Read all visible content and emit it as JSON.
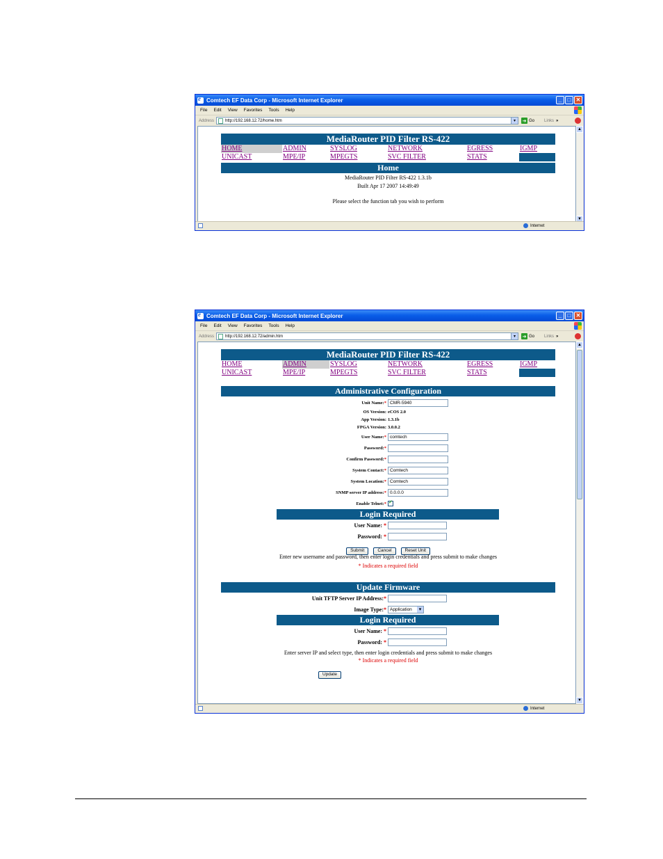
{
  "browser": {
    "title": "Comtech EF Data Corp - Microsoft Internet Explorer",
    "menu": [
      "File",
      "Edit",
      "View",
      "Favorites",
      "Tools",
      "Help"
    ],
    "address_label": "Address",
    "go_label": "Go",
    "links_label": "Links",
    "links_chevron": "»",
    "status_zone": "Internet"
  },
  "window_controls": {
    "minimize": "_",
    "maximize": "□",
    "close": "✕"
  },
  "win1": {
    "url": "http://192.168.12.72/home.htm",
    "header": "MediaRouter PID Filter RS-422",
    "nav_row1": [
      "HOME",
      "ADMIN",
      "SYSLOG",
      "NETWORK",
      "EGRESS",
      "IGMP"
    ],
    "nav_row2": [
      "UNICAST",
      "MPE/IP",
      "MPEGTS",
      "SVC FILTER",
      "STATS"
    ],
    "section": "Home",
    "version": "MediaRouter PID Filter RS-422 1.3.1b",
    "built": "Built Apr 17 2007 14:49:49",
    "prompt": "Please select the function tab you wish to perform"
  },
  "win2": {
    "url": "http://192.168.12.72/admin.htm",
    "header": "MediaRouter PID Filter RS-422",
    "nav_row1": [
      "HOME",
      "ADMIN",
      "SYSLOG",
      "NETWORK",
      "EGRESS",
      "IGMP"
    ],
    "nav_row2": [
      "UNICAST",
      "MPE/IP",
      "MPEGTS",
      "SVC FILTER",
      "STATS"
    ],
    "admin_section": "Administrative Configuration",
    "unit_name_label": "Unit Name:",
    "unit_name": "CMR-5940",
    "os_label": "OS Version:",
    "os": "eCOS 2.0",
    "app_label": "App Version:",
    "app": "1.3.1b",
    "fpga_label": "FPGA Version:",
    "fpga": "3.0.0.2",
    "user_label": "User Name:",
    "user": "comtech",
    "password_label": "Password:",
    "confirm_label": "Confirm Password:",
    "contact_label": "System Contact:",
    "contact": "Comtech",
    "location_label": "System Location:",
    "location": "Comtech",
    "snmp_label": "SNMP server IP address:",
    "snmp": "0.0.0.0",
    "telnet_label": "Enable Telnet:",
    "telnet_checked": true,
    "login_required": "Login Required",
    "login_user_label": "User Name:",
    "login_password_label": "Password:",
    "submit": "Submit",
    "cancel": "Cancel",
    "reset": "Reset Unit",
    "note1": "Enter new username and password, then enter login credentials and press submit to make changes",
    "required_note": "Indicates a required field",
    "firmware_section": "Update Firmware",
    "tftp_label": "Unit TFTP Server IP Address:",
    "image_label": "Image Type:",
    "image_value": "Application",
    "note2": "Enter server IP and select type, then enter login credentials and press submit to make changes",
    "update": "Update"
  },
  "required_marker": "*"
}
